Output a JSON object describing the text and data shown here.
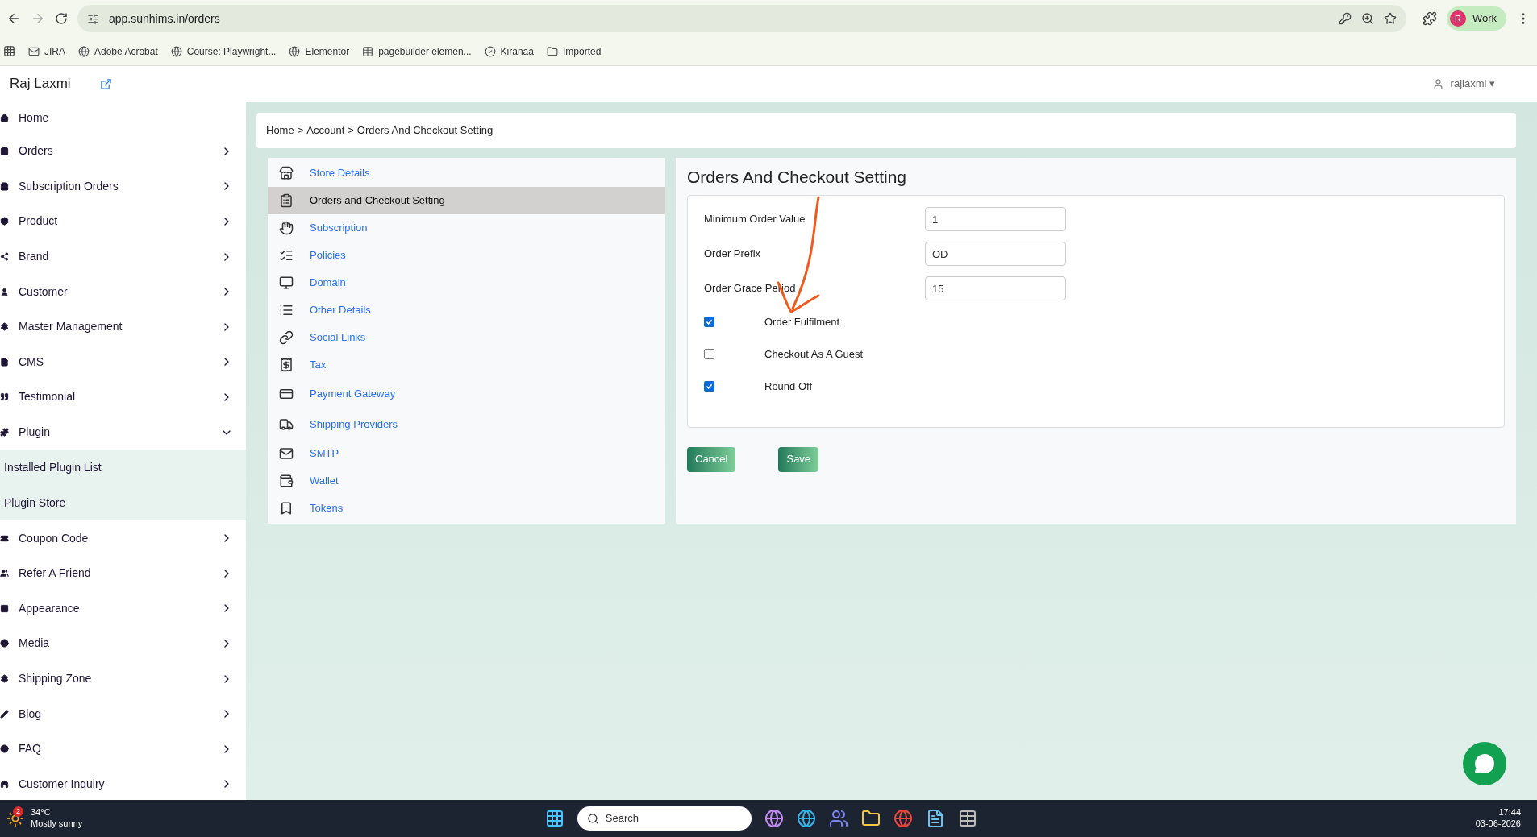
{
  "browser": {
    "url": "app.sunhims.in/orders",
    "profile": "Work",
    "profile_initial": "R",
    "bookmarks": [
      "JIRA",
      "Adobe Acrobat",
      "Course: Playwright...",
      "Elementor",
      "pagebuilder elemen...",
      "Kiranaa",
      "Imported"
    ]
  },
  "header": {
    "brand": "Raj Laxmi",
    "user": "rajlaxmi",
    "user_caret": "▾"
  },
  "sidebar": {
    "items": [
      {
        "label": "Home",
        "kind": "link"
      },
      {
        "label": "Orders",
        "kind": "group",
        "expanded": false
      },
      {
        "label": "Subscription Orders",
        "kind": "group",
        "expanded": false
      },
      {
        "label": "Product",
        "kind": "group",
        "expanded": false
      },
      {
        "label": "Brand",
        "kind": "group",
        "expanded": false
      },
      {
        "label": "Customer",
        "kind": "group",
        "expanded": false
      },
      {
        "label": "Master Management",
        "kind": "group",
        "expanded": false
      },
      {
        "label": "CMS",
        "kind": "group",
        "expanded": false
      },
      {
        "label": "Testimonial",
        "kind": "group",
        "expanded": false
      },
      {
        "label": "Plugin",
        "kind": "group",
        "expanded": true,
        "children": [
          {
            "label": "Installed Plugin List"
          },
          {
            "label": "Plugin Store"
          }
        ]
      },
      {
        "label": "Coupon Code",
        "kind": "group",
        "expanded": false
      },
      {
        "label": "Refer A Friend",
        "kind": "group",
        "expanded": false
      },
      {
        "label": "Appearance",
        "kind": "group",
        "expanded": false
      },
      {
        "label": "Media",
        "kind": "group",
        "expanded": false
      },
      {
        "label": "Shipping Zone",
        "kind": "group",
        "expanded": false
      },
      {
        "label": "Blog",
        "kind": "group",
        "expanded": false
      },
      {
        "label": "FAQ",
        "kind": "group",
        "expanded": false
      },
      {
        "label": "Customer Inquiry",
        "kind": "group",
        "expanded": false
      }
    ]
  },
  "breadcrumb": {
    "separator": ">",
    "items": [
      "Home",
      "Account",
      "Orders And Checkout Setting"
    ]
  },
  "settings_menu": [
    {
      "label": "Store Details",
      "selected": false
    },
    {
      "label": "Orders and Checkout Setting",
      "selected": true
    },
    {
      "label": "Subscription",
      "selected": false
    },
    {
      "label": "Policies",
      "selected": false
    },
    {
      "label": "Domain",
      "selected": false
    },
    {
      "label": "Other Details",
      "selected": false
    },
    {
      "label": "Social Links",
      "selected": false
    },
    {
      "label": "Tax",
      "selected": false
    },
    {
      "label": "Payment Gateway",
      "selected": false
    },
    {
      "label": "Shipping Providers",
      "selected": false
    },
    {
      "label": "SMTP",
      "selected": false
    },
    {
      "label": "Wallet",
      "selected": false
    },
    {
      "label": "Tokens",
      "selected": false
    }
  ],
  "form": {
    "title": "Orders And Checkout Setting",
    "fields": [
      {
        "label": "Minimum Order Value",
        "value": "1"
      },
      {
        "label": "Order Prefix",
        "value": "OD"
      },
      {
        "label": "Order Grace Period",
        "value": "15"
      }
    ],
    "checkboxes": [
      {
        "label": "Order Fulfilment",
        "checked": true
      },
      {
        "label": "Checkout As A Guest",
        "checked": false
      },
      {
        "label": "Round Off",
        "checked": true
      }
    ],
    "buttons": [
      "Cancel",
      "Save"
    ]
  },
  "taskbar": {
    "badge": "2",
    "temperature": "34°C",
    "weather": "Mostly sunny",
    "search_placeholder": "Search",
    "time": "17:44",
    "date": "03-06-2026"
  }
}
